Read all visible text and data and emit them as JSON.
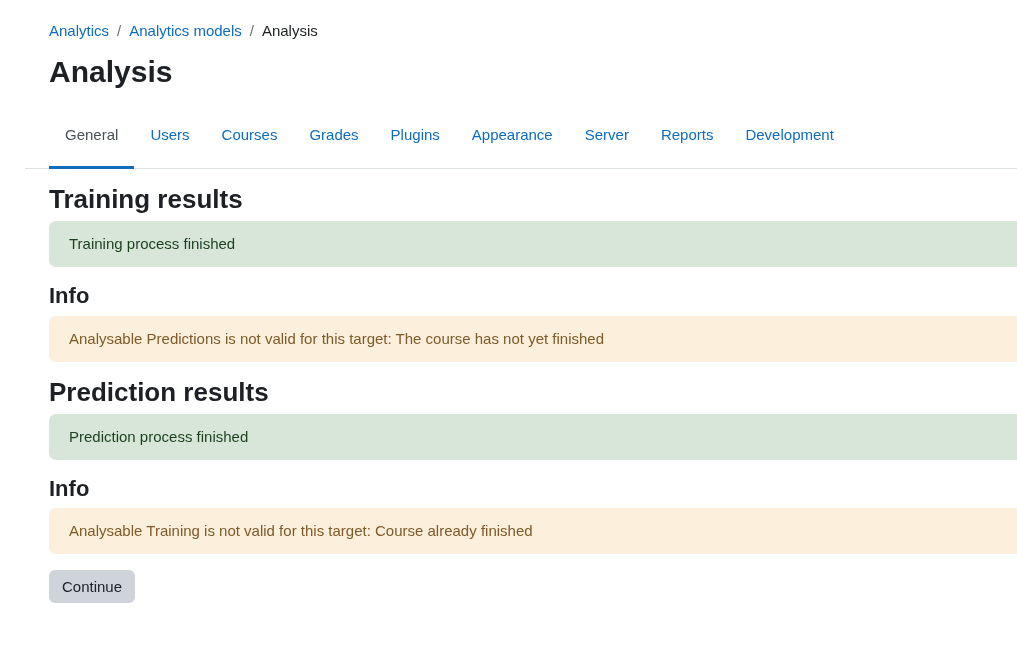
{
  "breadcrumb": {
    "separator": "/",
    "items": [
      {
        "label": "Analytics",
        "link": true
      },
      {
        "label": "Analytics models",
        "link": true
      },
      {
        "label": "Analysis",
        "link": false
      }
    ]
  },
  "title": "Analysis",
  "tabs": [
    {
      "label": "General",
      "selected": true
    },
    {
      "label": "Users",
      "selected": false
    },
    {
      "label": "Courses",
      "selected": false
    },
    {
      "label": "Grades",
      "selected": false
    },
    {
      "label": "Plugins",
      "selected": false
    },
    {
      "label": "Appearance",
      "selected": false
    },
    {
      "label": "Server",
      "selected": false
    },
    {
      "label": "Reports",
      "selected": false
    },
    {
      "label": "Development",
      "selected": false
    }
  ],
  "blocks": [
    {
      "kind": "heading",
      "text": "Training results"
    },
    {
      "kind": "success",
      "text": "Training process finished"
    },
    {
      "kind": "subheading",
      "text": "Info"
    },
    {
      "kind": "warning",
      "text": "Analysable Predictions is not valid for this target: The course has not yet finished"
    },
    {
      "kind": "heading",
      "text": "Prediction results"
    },
    {
      "kind": "success",
      "text": "Prediction process finished"
    },
    {
      "kind": "subheading",
      "text": "Info"
    },
    {
      "kind": "warning",
      "text": "Analysable Training is not valid for this target: Course already finished"
    }
  ],
  "button": "Continue"
}
